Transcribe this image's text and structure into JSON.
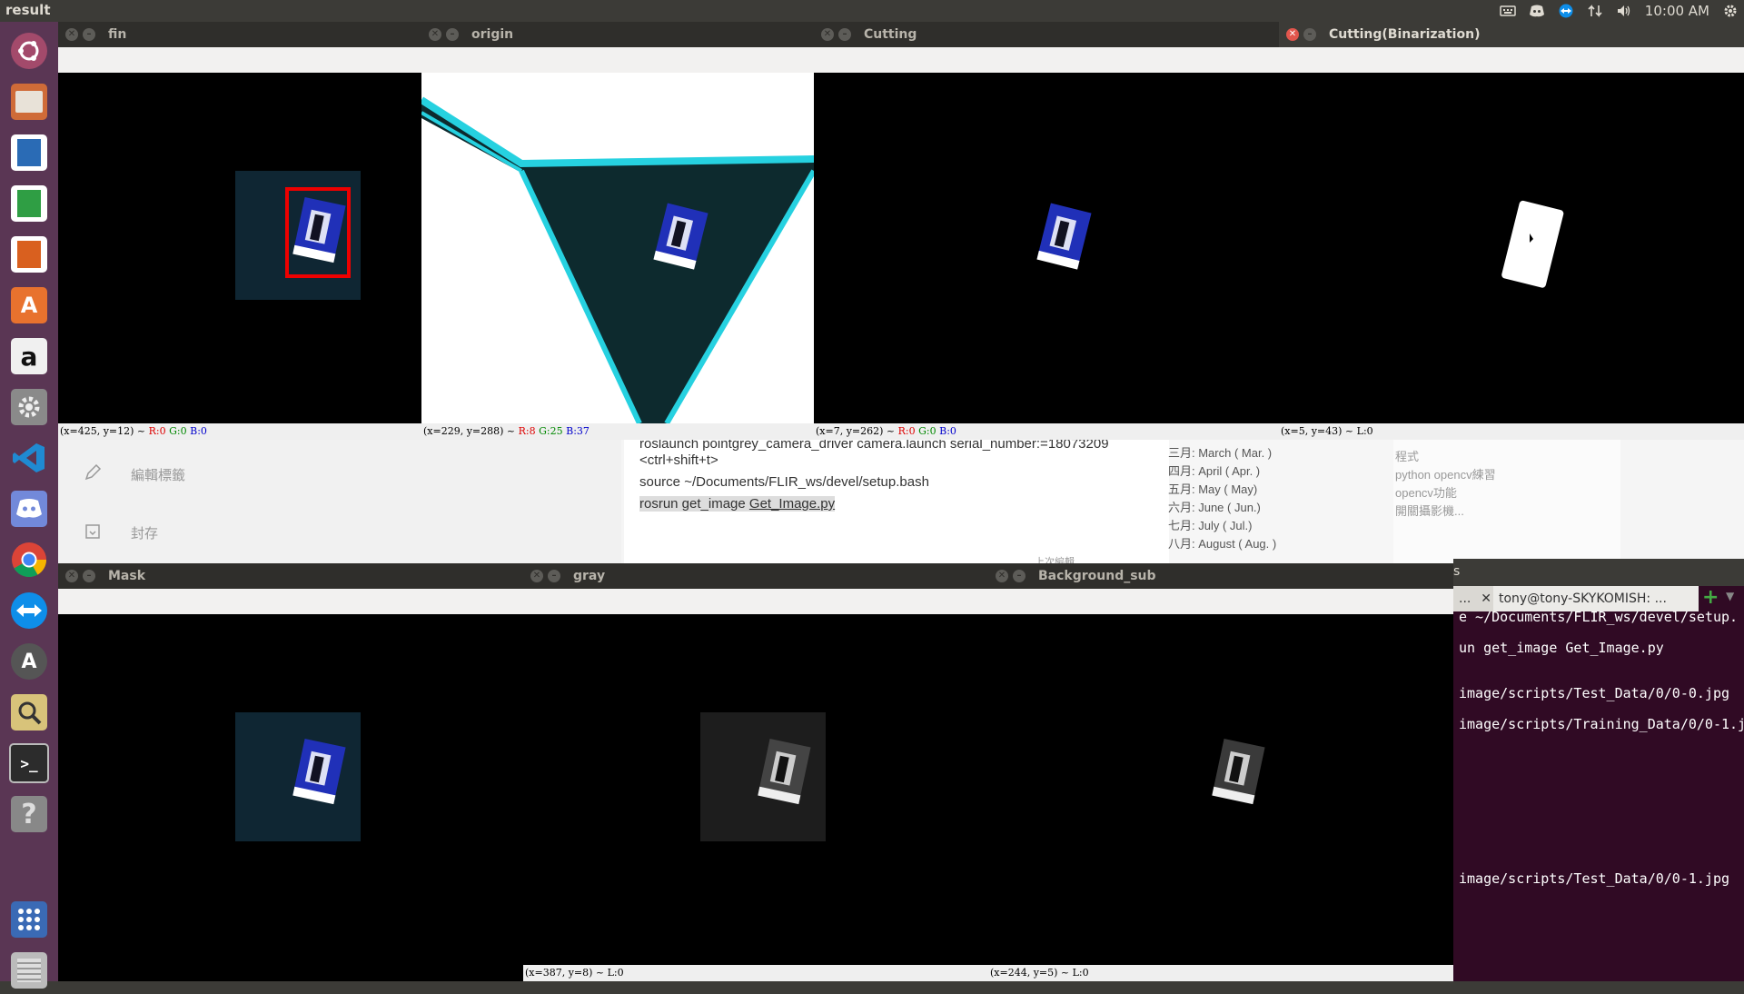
{
  "topbar": {
    "title": "result",
    "clock": "10:00 AM",
    "icons": [
      "keyboard-icon",
      "discord-tray-icon",
      "teamviewer-tray-icon",
      "network-icon",
      "volume-icon",
      "gear-icon"
    ]
  },
  "launcher": {
    "icons": [
      "ubuntu-dash-icon",
      "files-icon",
      "writer-icon",
      "calc-icon",
      "impress-icon",
      "software-center-icon",
      "amazon-icon",
      "system-settings-icon",
      "vscode-icon",
      "discord-icon",
      "chrome-icon",
      "teamviewer-icon",
      "software-updater-icon",
      "image-viewer-icon",
      "terminal-icon",
      "help-icon",
      "show-apps-icon",
      "trash-icon"
    ]
  },
  "background_doc": {
    "edit_label": "編輯標籤",
    "archive_label": "封存",
    "cmd_line1": "roslaunch pointgrey_camera_driver camera.launch serial_number:=18073209",
    "cmd_line2": "<ctrl+shift+t>",
    "cmd_line3": "source ~/Documents/FLIR_ws/devel/setup.bash",
    "cmd_line4_prefix": "rosrun get_image ",
    "cmd_line4_link": "Get_Image.py",
    "months": [
      "三月: March ( Mar. )",
      "四月: April ( Apr. )",
      "五月: May ( May)",
      "六月: June ( Jun.)",
      "七月: July ( Jul.)",
      "八月: August ( Aug. )"
    ],
    "side_items": [
      "程式",
      "python opencv練習",
      "opencv功能",
      "開關攝影機..."
    ],
    "prev_label": "上次編輯"
  },
  "windows": {
    "fin": {
      "title": "fin",
      "status_prefix": "(x=425, y=12) ~ ",
      "r": "R:0",
      "g": "G:0",
      "b": "B:0"
    },
    "origin": {
      "title": "origin",
      "status_prefix": "(x=229, y=288) ~ ",
      "r": "R:8",
      "g": "G:25",
      "b": "B:37"
    },
    "cutting": {
      "title": "Cutting",
      "status_prefix": "(x=7, y=262) ~ ",
      "r": "R:0",
      "g": "G:0",
      "b": "B:0"
    },
    "binarization": {
      "title": "Cutting(Binarization)",
      "status": "(x=5, y=43) ~ L:0"
    },
    "mask": {
      "title": "Mask"
    },
    "gray": {
      "title": "gray",
      "status": "(x=387, y=8) ~ L:0"
    },
    "background_sub": {
      "title": "Background_sub",
      "status": "(x=244, y=5) ~ L:0"
    }
  },
  "terminal": {
    "tab1": "...",
    "tab2": "tony@tony-SKYKOMISH: ...",
    "lines": [
      "e ~/Documents/FLIR_ws/devel/setup.",
      "un get_image Get_Image.py",
      "image/scripts/Test_Data/0/0-0.jpg",
      "image/scripts/Training_Data/0/0-1.j",
      "image/scripts/Test_Data/0/0-1.jpg"
    ],
    "partial_title": "s"
  }
}
